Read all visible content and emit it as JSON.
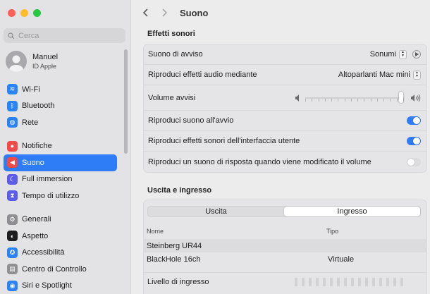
{
  "sidebar": {
    "search_placeholder": "Cerca",
    "account": {
      "name": "Manuel",
      "subtitle": "ID Apple"
    },
    "items": [
      {
        "label": "Wi-Fi",
        "icon": "wifi-icon",
        "color": "#2b84f7"
      },
      {
        "label": "Bluetooth",
        "icon": "bluetooth-icon",
        "color": "#2b84f7"
      },
      {
        "label": "Rete",
        "icon": "globe-icon",
        "color": "#2b84f7"
      },
      {
        "label": "Notifiche",
        "icon": "bell-icon",
        "color": "#f04a4a"
      },
      {
        "label": "Suono",
        "icon": "speaker-icon",
        "color": "#f04a4a",
        "selected": true
      },
      {
        "label": "Full immersion",
        "icon": "moon-icon",
        "color": "#5c5ce6"
      },
      {
        "label": "Tempo di utilizzo",
        "icon": "hourglass-icon",
        "color": "#5c5ce6"
      },
      {
        "label": "Generali",
        "icon": "gear-icon",
        "color": "#8e8e93"
      },
      {
        "label": "Aspetto",
        "icon": "appearance-icon",
        "color": "#1d1d1f"
      },
      {
        "label": "Accessibilità",
        "icon": "accessibility-icon",
        "color": "#2b84f7"
      },
      {
        "label": "Centro di Controllo",
        "icon": "control-center-icon",
        "color": "#8e8e93"
      },
      {
        "label": "Siri e Spotlight",
        "icon": "siri-icon",
        "color": "#2b84f7"
      }
    ]
  },
  "header": {
    "title": "Suono"
  },
  "effetti": {
    "title": "Effetti sonori",
    "alert_sound_label": "Suono di avviso",
    "alert_sound_value": "Sonumi",
    "play_output_label": "Riproduci effetti audio mediante",
    "play_output_value": "Altoparlanti Mac mini",
    "alert_volume_label": "Volume avvisi",
    "alert_volume_level": 0.97,
    "startup_label": "Riproduci suono all'avvio",
    "startup_on": true,
    "ui_sounds_label": "Riproduci effetti sonori dell'interfaccia utente",
    "ui_sounds_on": true,
    "feedback_label": "Riproduci un suono di risposta quando viene modificato il volume",
    "feedback_on": false
  },
  "io": {
    "title": "Uscita e ingresso",
    "tabs": [
      "Uscita",
      "Ingresso"
    ],
    "active_tab": "Ingresso",
    "columns": [
      "Nome",
      "Tipo"
    ],
    "devices": [
      {
        "name": "Steinberg UR44",
        "type": ""
      },
      {
        "name": "BlackHole 16ch",
        "type": "Virtuale"
      }
    ],
    "level_label": "Livello di ingresso"
  },
  "colors": {
    "accent": "#2e7cf6",
    "toggle_off": "#dcdcde"
  }
}
